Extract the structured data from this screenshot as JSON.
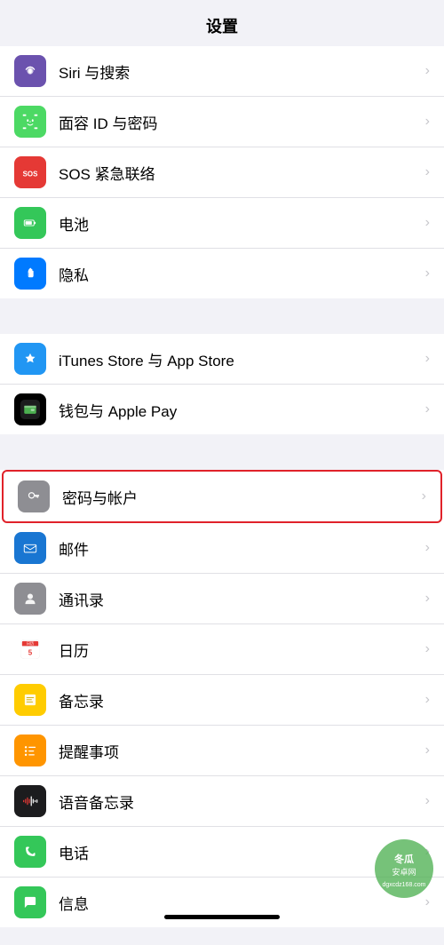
{
  "page": {
    "title": "设置"
  },
  "groups": [
    {
      "id": "group1",
      "items": [
        {
          "id": "siri",
          "label": "Siri 与搜索",
          "icon": "siri",
          "iconBg": "bg-purple"
        },
        {
          "id": "faceid",
          "label": "面容 ID 与密码",
          "icon": "faceid",
          "iconBg": "bg-green-face"
        },
        {
          "id": "sos",
          "label": "SOS 紧急联络",
          "icon": "sos",
          "iconBg": "bg-red"
        },
        {
          "id": "battery",
          "label": "电池",
          "icon": "battery",
          "iconBg": "bg-green"
        },
        {
          "id": "privacy",
          "label": "隐私",
          "icon": "hand",
          "iconBg": "bg-blue-hand"
        }
      ]
    },
    {
      "id": "group2",
      "items": [
        {
          "id": "itunes",
          "label": "iTunes Store 与 App Store",
          "icon": "appstore",
          "iconBg": "bg-blue-appstore"
        },
        {
          "id": "wallet",
          "label": "钱包与 Apple Pay",
          "icon": "wallet",
          "iconBg": "bg-green-wallet"
        }
      ]
    },
    {
      "id": "group3",
      "items": [
        {
          "id": "passwords",
          "label": "密码与帐户",
          "icon": "key",
          "iconBg": "bg-gray-key",
          "highlighted": true
        },
        {
          "id": "mail",
          "label": "邮件",
          "icon": "mail",
          "iconBg": "bg-blue-mail"
        },
        {
          "id": "contacts",
          "label": "通讯录",
          "icon": "contacts",
          "iconBg": "bg-gray-contacts"
        },
        {
          "id": "calendar",
          "label": "日历",
          "icon": "calendar",
          "iconBg": "bg-red-calendar"
        },
        {
          "id": "notes",
          "label": "备忘录",
          "icon": "notes",
          "iconBg": "bg-yellow-notes"
        },
        {
          "id": "reminders",
          "label": "提醒事项",
          "icon": "reminders",
          "iconBg": "bg-orange-reminders"
        },
        {
          "id": "voicememo",
          "label": "语音备忘录",
          "icon": "voicememo",
          "iconBg": "bg-red-voice"
        },
        {
          "id": "phone",
          "label": "电话",
          "icon": "phone",
          "iconBg": "bg-green-phone"
        },
        {
          "id": "messages",
          "label": "信息",
          "icon": "messages",
          "iconBg": "bg-green-messages"
        }
      ]
    }
  ]
}
